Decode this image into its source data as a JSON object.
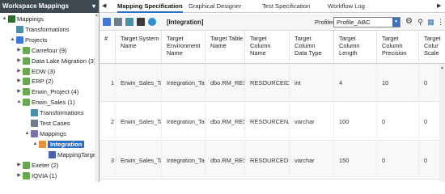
{
  "left_panel": {
    "title": "Workspace Mappings",
    "tree": [
      {
        "label": "Mappings",
        "icon": "mappings-root-icon",
        "arrow": "▲"
      },
      {
        "label": "Transformations",
        "icon": "transformations-icon",
        "arrow": ""
      },
      {
        "label": "Projects",
        "icon": "projects-icon",
        "arrow": "▲"
      },
      {
        "label": "Carrefour (9)",
        "icon": "folder-icon",
        "arrow": "▶"
      },
      {
        "label": "Data Lake Migration (3)",
        "icon": "folder-icon",
        "arrow": "▶"
      },
      {
        "label": "EDW (3)",
        "icon": "folder-icon",
        "arrow": "▶"
      },
      {
        "label": "ERP (2)",
        "icon": "folder-icon",
        "arrow": "▶"
      },
      {
        "label": "Erwin_Project (4)",
        "icon": "folder-icon",
        "arrow": "▶"
      },
      {
        "label": "Erwin_Sales (1)",
        "icon": "folder-icon",
        "arrow": "▲"
      },
      {
        "label": "Transformations",
        "icon": "transformations-icon",
        "arrow": ""
      },
      {
        "label": "Test Cases",
        "icon": "test-cases-icon",
        "arrow": ""
      },
      {
        "label": "Mappings",
        "icon": "mappings-icon",
        "arrow": "▲"
      },
      {
        "label": "Integration",
        "icon": "mapping-folder-icon",
        "arrow": "▲"
      },
      {
        "label": "MappingTargets",
        "icon": "mapping-targets-icon",
        "arrow": ""
      },
      {
        "label": "Exeter (2)",
        "icon": "folder-icon",
        "arrow": "▶"
      },
      {
        "label": "IQVIA (1)",
        "icon": "folder-icon",
        "arrow": "▶"
      }
    ]
  },
  "tabs": [
    "Mapping Specification",
    "Graphical Designer",
    "Test Specification",
    "Workflow Log"
  ],
  "toolbar": {
    "title": "[Integration]",
    "profiles_label": "Profiles:",
    "profile_value": "Profile_ABC"
  },
  "grid": {
    "headers": [
      [
        "#"
      ],
      [
        "Target System",
        "Name"
      ],
      [
        "Target",
        "Environment",
        "Name"
      ],
      [
        "Target Table",
        "Name"
      ],
      [
        "Target Column",
        "Name"
      ],
      [
        "Target Column",
        "Data Type"
      ],
      [
        "Target Column",
        "Length"
      ],
      [
        "Target Column",
        "Precision"
      ],
      [
        "Target Colur",
        "Scale"
      ]
    ],
    "rows": [
      [
        "1",
        "Erwin_Sales_Targe",
        "Integration_Targe",
        "dbo.RM_RESOURC",
        "RESOURCEID_New",
        "int",
        "4",
        "10",
        "0"
      ],
      [
        "2",
        "Erwin_Sales_Targe",
        "Integration_Targe",
        "dbo.RM_RESOURC",
        "RESOURCENAME_",
        "varchar",
        "100",
        "0",
        "0"
      ],
      [
        "3",
        "Erwin_Sales_Targe",
        "Integration_Targe",
        "dbo.RM_RESOURC",
        "RESOURCEDESC_N",
        "varchar",
        "150",
        "0",
        "0"
      ]
    ]
  },
  "colors": {
    "header_dark": "#3f4952",
    "accent_blue": "#2b6ec4",
    "selection": "#2b6ec4"
  }
}
